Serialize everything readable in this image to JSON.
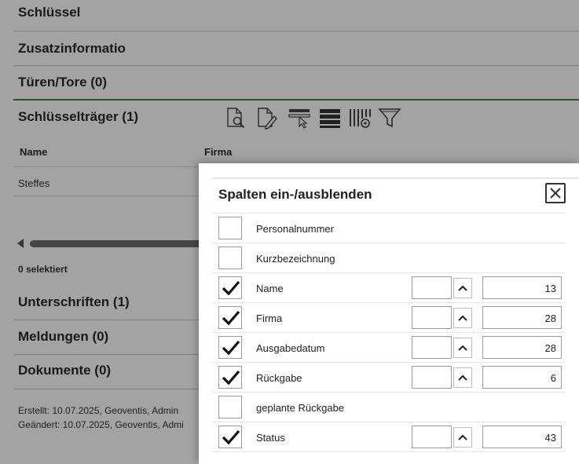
{
  "sections": {
    "schluessel": "Schlüssel",
    "zusatzinfo": "Zusatzinformatio",
    "tueren": "Türen/Tore (0)",
    "schluesseltraeger": "Schlüsselträger (1)",
    "unterschriften": "Unterschriften (1)",
    "meldungen": "Meldungen (0)",
    "dokumente": "Dokumente (0)"
  },
  "toolbar": {
    "icons": [
      "document-search-icon",
      "document-edit-icon",
      "select-columns-icon",
      "rows-icon",
      "column-settings-icon",
      "filter-icon"
    ]
  },
  "table": {
    "headers": {
      "name": "Name",
      "firma": "Firma"
    },
    "rows": [
      {
        "name": "Steffes"
      }
    ]
  },
  "selection_text": "0 selektiert",
  "meta": {
    "erstellt": "Erstellt:  10.07.2025, Geoventis, Admin",
    "geaendert": "Geändert:  10.07.2025, Geoventis, Admi"
  },
  "dialog": {
    "title": "Spalten ein-/ausblenden",
    "columns": [
      {
        "label": "Personalnummer",
        "checked": false,
        "width": null
      },
      {
        "label": "Kurzbezeichnung",
        "checked": false,
        "width": null
      },
      {
        "label": "Name",
        "checked": true,
        "width": "13"
      },
      {
        "label": "Firma",
        "checked": true,
        "width": "28"
      },
      {
        "label": "Ausgabedatum",
        "checked": true,
        "width": "28"
      },
      {
        "label": "Rückgabe",
        "checked": true,
        "width": "6"
      },
      {
        "label": "geplante Rückgabe",
        "checked": false,
        "width": null
      },
      {
        "label": "Status",
        "checked": true,
        "width": "43"
      }
    ]
  },
  "colors": {
    "accent_green": "#2f8a3a",
    "overlay": "rgba(0,0,0,0.36)"
  }
}
